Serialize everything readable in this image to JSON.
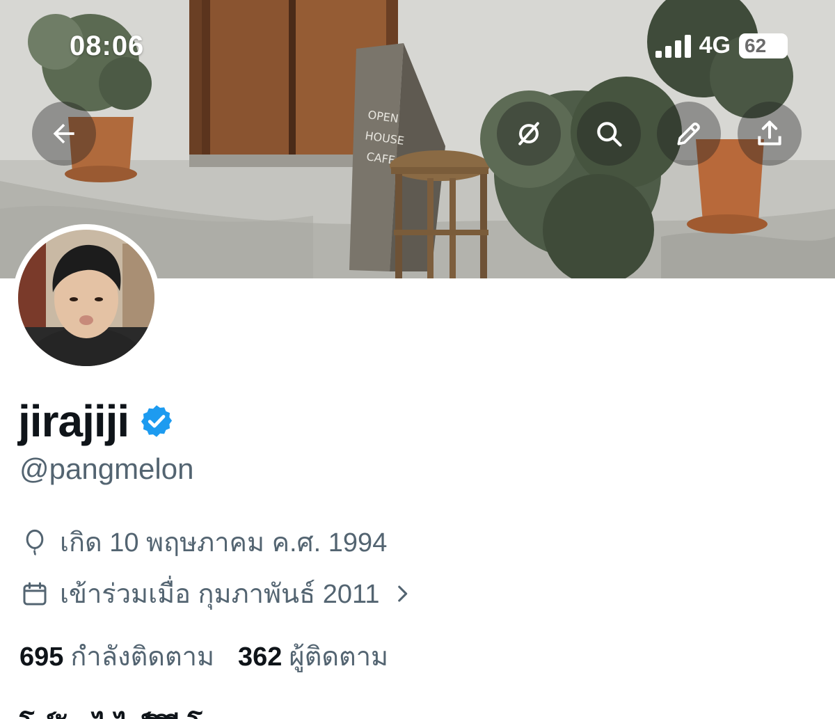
{
  "status_bar": {
    "time": "08:06",
    "network": "4G",
    "battery": "62"
  },
  "header_actions": {
    "back": "arrow-left-icon",
    "grok": "grok-icon",
    "search": "search-icon",
    "edit": "pencil-icon",
    "share": "share-icon"
  },
  "profile": {
    "display_name": "jirajiji",
    "verified": true,
    "handle": "@pangmelon",
    "birth": "เกิด 10 พฤษภาคม ค.ศ. 1994",
    "joined": "เข้าร่วมเมื่อ กุมภาพันธ์ 2011",
    "following_count": "695",
    "following_label": "กำลังติดตาม",
    "followers_count": "362",
    "followers_label": "ผู้ติดตาม",
    "bio_partial": "โ      ร์                                ัน      ไ     ไ     ร์      ิ  ิ   ี  โ         "
  },
  "colors": {
    "primary_text": "#0f1419",
    "secondary_text": "#536471",
    "verified_blue": "#1d9bf0"
  }
}
